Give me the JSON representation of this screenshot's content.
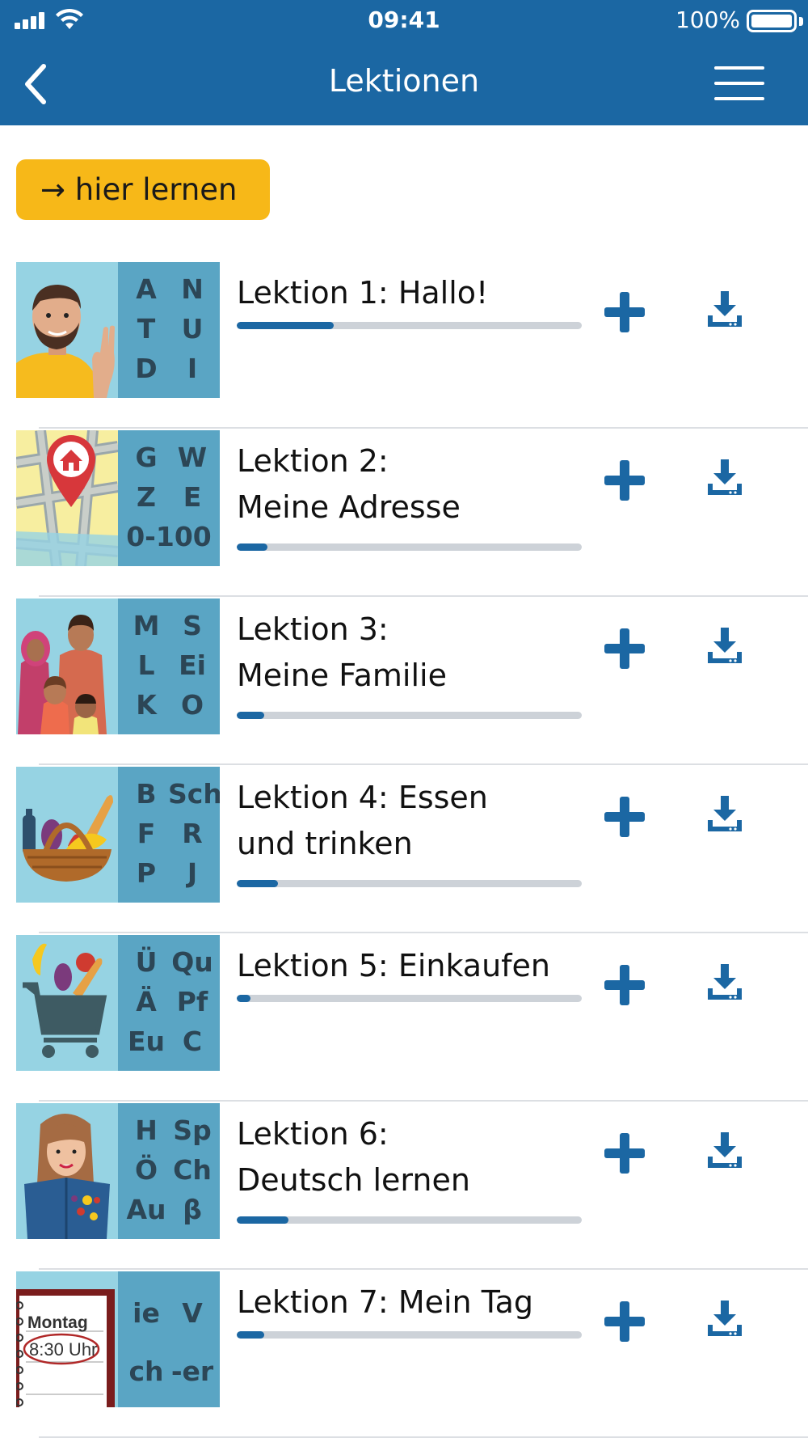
{
  "status_bar": {
    "time": "09:41",
    "battery": "100%"
  },
  "nav": {
    "title": "Lektionen",
    "back_icon": "chevron-left-icon",
    "menu_icon": "hamburger-menu-icon"
  },
  "learn_button": {
    "label": "→ hier lernen",
    "color": "#f7b818"
  },
  "colors": {
    "primary": "#1b67a3",
    "track": "#cdd2d8",
    "thumb_bg": "#96d3e3",
    "letters_bg": "#5aa5c4"
  },
  "lessons": [
    {
      "title_lines": [
        "Lektion 1: Hallo!"
      ],
      "letters": [
        "A",
        "N",
        "T",
        "U",
        "D",
        "I"
      ],
      "progress": 0.28,
      "image": "man-waving"
    },
    {
      "title_lines": [
        "Lektion 2:",
        "Meine Adresse"
      ],
      "letters": [
        "G",
        "W",
        "Z",
        "E",
        "0-100"
      ],
      "progress": 0.09,
      "image": "map-pin-house"
    },
    {
      "title_lines": [
        "Lektion 3:",
        "Meine Familie"
      ],
      "letters": [
        "M",
        "S",
        "L",
        "Ei",
        "K",
        "O"
      ],
      "progress": 0.08,
      "image": "family"
    },
    {
      "title_lines": [
        "Lektion 4: Essen",
        "und trinken"
      ],
      "letters": [
        "B",
        "Sch",
        "F",
        "R",
        "P",
        "J"
      ],
      "progress": 0.12,
      "image": "food-basket"
    },
    {
      "title_lines": [
        "Lektion 5: Einkaufen"
      ],
      "letters": [
        "Ü",
        "Qu",
        "Ä",
        "Pf",
        "Eu",
        "C"
      ],
      "progress": 0.04,
      "image": "shopping-cart"
    },
    {
      "title_lines": [
        "Lektion 6:",
        "Deutsch lernen"
      ],
      "letters": [
        "H",
        "Sp",
        "Ö",
        "Ch",
        "Au",
        "β"
      ],
      "progress": 0.15,
      "image": "woman-reading"
    },
    {
      "title_lines": [
        "Lektion 7: Mein Tag"
      ],
      "letters": [
        "ie",
        "V",
        "ch",
        "-er"
      ],
      "progress": 0.08,
      "image": "calendar",
      "image_text": [
        "Montag",
        "8:30 Uhr"
      ]
    }
  ]
}
